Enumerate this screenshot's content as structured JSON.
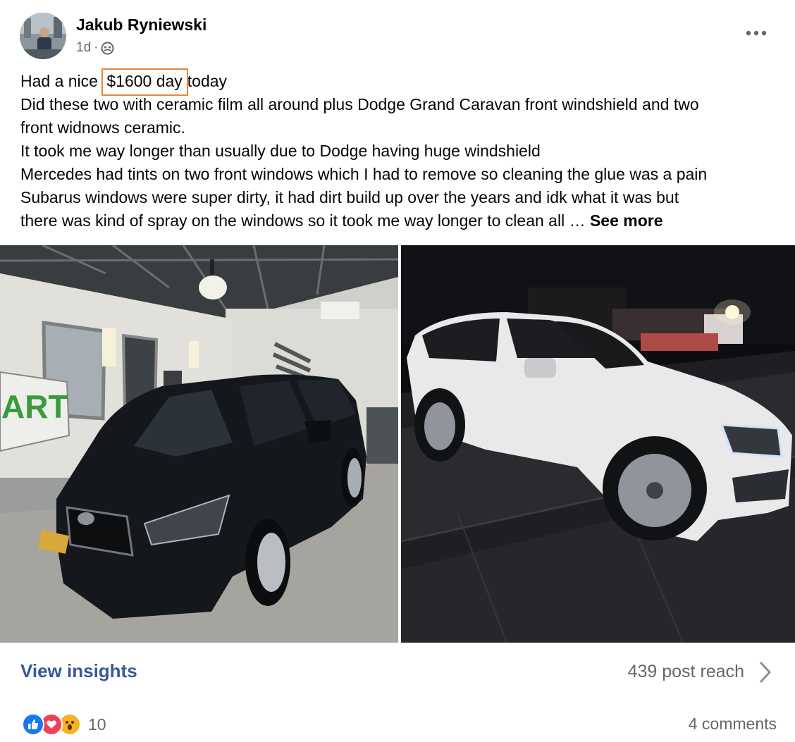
{
  "post": {
    "author": "Jakub Ryniewski",
    "time": "1d",
    "separator": "·",
    "privacy_icon": "globe-icon",
    "more_icon": "ellipsis-icon",
    "text": {
      "line1_before": "Had a nice ",
      "line1_highlight": "$1600 day",
      "line1_after": "today",
      "line2": "Did these two with ceramic film all around plus Dodge Grand Caravan front windshield and two",
      "line3": "front widnows ceramic.",
      "line4": "It took me way longer than usually due to Dodge having huge windshield",
      "line5": "Mercedes had tints on two front windows which I had to remove so cleaning the glue was a pain",
      "line6": "Subarus windows were super dirty, it had dirt build up over the years and idk what it was but",
      "line7": "there was kind of spray on the windows so it took me way longer to clean all … ",
      "see_more": "See more"
    },
    "highlight_color": "#e8863a"
  },
  "photos": [
    {
      "subject": "Black Subaru Forester in garage",
      "sign_text": "ART"
    },
    {
      "subject": "White Mercedes SUV at night"
    }
  ],
  "insights": {
    "view_label": "View insights",
    "reach_label": "439 post reach",
    "chevron_icon": "chevron-right-icon"
  },
  "reactions": {
    "icons": [
      "like-icon",
      "love-icon",
      "wow-icon"
    ],
    "count": "10",
    "comments": "4 comments"
  },
  "colors": {
    "link": "#385898",
    "secondary_text": "#65676b",
    "like": "#1877f2",
    "love": "#f33e58",
    "wow": "#f7b125"
  }
}
